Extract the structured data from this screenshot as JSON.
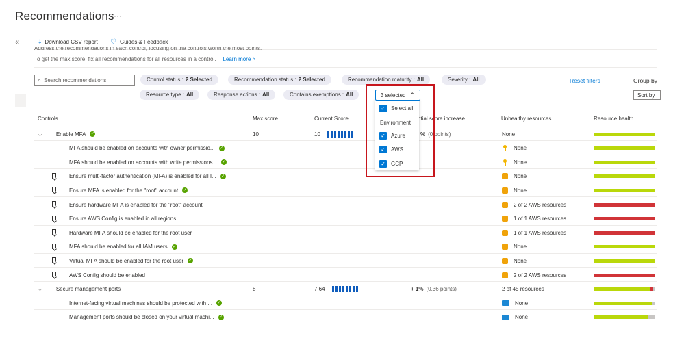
{
  "page": {
    "title": "Recommendations",
    "more": "···",
    "collapse": "«"
  },
  "toolbar": {
    "download_label": "Download CSV report",
    "guides_label": "Guides & Feedback"
  },
  "notes": {
    "line1": "Address the recommendations in each control, focusing on the controls worth the most points.",
    "line2": "To get the max score, fix all recommendations for all resources in a control.",
    "learn_more": "Learn more >"
  },
  "search": {
    "placeholder": "Search recommendations"
  },
  "filters": [
    {
      "label": "Control status :",
      "value": "2 Selected"
    },
    {
      "label": "Recommendation status :",
      "value": "2 Selected"
    },
    {
      "label": "Recommendation maturity :",
      "value": "All"
    },
    {
      "label": "Severity :",
      "value": "All"
    },
    {
      "label": "Resource type :",
      "value": "All"
    },
    {
      "label": "Response actions :",
      "value": "All"
    },
    {
      "label": "Contains exemptions :",
      "value": "All"
    }
  ],
  "reset_filters": "Reset filters",
  "group_by": "Group by",
  "sort_by": "Sort by",
  "environment_dropdown": {
    "button_label": "3 selected",
    "select_all": "Select all",
    "group_label": "Environment",
    "options": [
      "Azure",
      "AWS",
      "GCP"
    ]
  },
  "columns": {
    "controls": "Controls",
    "max_score": "Max score",
    "current_score": "Current Score",
    "potential_increase": "ntial score increase",
    "unhealthy": "Unhealthy resources",
    "health": "Resource health"
  },
  "groups": [
    {
      "name": "Enable MFA",
      "max_score": "10",
      "current_score": "10",
      "increase_pct": "%",
      "increase_points": "(0 points)",
      "unhealthy": "None",
      "health": {
        "green": 1.0,
        "red": 0,
        "grey": 0
      },
      "items": [
        {
          "name": "MFA should be enabled on accounts with owner permissio...",
          "check": true,
          "bookmark": false,
          "icon": "iam",
          "unhealthy": "None",
          "health": {
            "green": 1.0,
            "red": 0,
            "grey": 0
          }
        },
        {
          "name": "MFA should be enabled on accounts with write permissions...",
          "check": true,
          "bookmark": false,
          "icon": "iam",
          "unhealthy": "None",
          "health": {
            "green": 1.0,
            "red": 0,
            "grey": 0
          }
        },
        {
          "name": "Ensure multi-factor authentication (MFA) is enabled for all I...",
          "check": true,
          "bookmark": true,
          "icon": "aws",
          "unhealthy": "None",
          "health": {
            "green": 1.0,
            "red": 0,
            "grey": 0
          }
        },
        {
          "name": "Ensure MFA is enabled for the \"root\" account",
          "check": true,
          "bookmark": true,
          "icon": "aws",
          "unhealthy": "None",
          "health": {
            "green": 1.0,
            "red": 0,
            "grey": 0
          }
        },
        {
          "name": "Ensure hardware MFA is enabled for the \"root\" account",
          "check": false,
          "bookmark": true,
          "icon": "aws",
          "unhealthy": "2 of 2 AWS resources",
          "health": {
            "green": 0,
            "red": 1.0,
            "grey": 0
          }
        },
        {
          "name": "Ensure AWS Config is enabled in all regions",
          "check": false,
          "bookmark": true,
          "icon": "aws",
          "unhealthy": "1 of 1 AWS resources",
          "health": {
            "green": 0,
            "red": 1.0,
            "grey": 0
          }
        },
        {
          "name": "Hardware MFA should be enabled for the root user",
          "check": false,
          "bookmark": true,
          "icon": "aws",
          "unhealthy": "1 of 1 AWS resources",
          "health": {
            "green": 0,
            "red": 1.0,
            "grey": 0
          }
        },
        {
          "name": "MFA should be enabled for all IAM users",
          "check": true,
          "bookmark": true,
          "icon": "aws",
          "unhealthy": "None",
          "health": {
            "green": 1.0,
            "red": 0,
            "grey": 0
          }
        },
        {
          "name": "Virtual MFA should be enabled for the root user",
          "check": true,
          "bookmark": true,
          "icon": "aws",
          "unhealthy": "None",
          "health": {
            "green": 1.0,
            "red": 0,
            "grey": 0
          }
        },
        {
          "name": "AWS Config should be enabled",
          "check": false,
          "bookmark": true,
          "icon": "aws",
          "unhealthy": "2 of 2 AWS resources",
          "health": {
            "green": 0,
            "red": 1.0,
            "grey": 0
          }
        }
      ]
    },
    {
      "name": "Secure management ports",
      "max_score": "8",
      "current_score": "7.64",
      "increase_pct": "+ 1%",
      "increase_points": "(0.36 points)",
      "unhealthy": "2 of 45 resources",
      "health": {
        "green": 0.93,
        "red": 0.04,
        "grey": 0.03
      },
      "items": [
        {
          "name": "Internet-facing virtual machines should be protected with ...",
          "check": true,
          "bookmark": false,
          "icon": "vm",
          "unhealthy": "None",
          "health": {
            "green": 0.96,
            "red": 0,
            "grey": 0.04
          }
        },
        {
          "name": "Management ports should be closed on your virtual machi...",
          "check": true,
          "bookmark": false,
          "icon": "vm",
          "unhealthy": "None",
          "health": {
            "green": 0.9,
            "red": 0,
            "grey": 0.1
          }
        }
      ]
    }
  ],
  "colors": {
    "green": "#bad80a",
    "red": "#d13438",
    "grey": "#c8c6c4",
    "blue": "#0078d4",
    "highlight": "#c7161d"
  }
}
